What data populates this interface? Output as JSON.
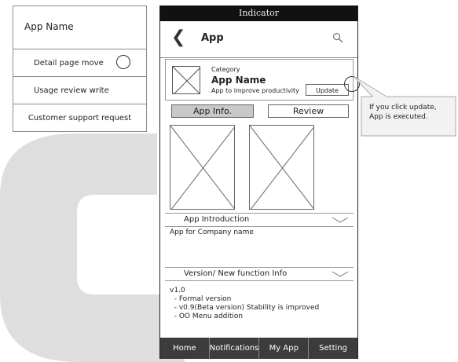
{
  "menu": {
    "title": "App Name",
    "items": [
      {
        "label": "Detail page move"
      },
      {
        "label": "Usage review write"
      },
      {
        "label": "Customer support request"
      }
    ]
  },
  "phone": {
    "status_title": "Indicator",
    "nav": {
      "back_icon": "chevron-left-icon",
      "title": "App",
      "search_icon": "search-icon"
    },
    "app": {
      "category": "Category",
      "name": "App Name",
      "description": "App to improve productivity",
      "update_label": "Update"
    },
    "tabs": [
      {
        "label": "App Info."
      },
      {
        "label": "Review"
      }
    ],
    "intro": {
      "title": "App Introduction",
      "text": "App for Company name"
    },
    "version_section": {
      "title": "Version/ New function Info",
      "lines": [
        "v1.0",
        "  - Formal version",
        "  - v0.9(Beta version) Stability is improved",
        "  - OO Menu addition"
      ]
    },
    "tabbar": [
      {
        "label": "Home"
      },
      {
        "label": "Notifications"
      },
      {
        "label": "My App"
      },
      {
        "label": "Setting"
      }
    ]
  },
  "callout": {
    "line1": "If you click update,",
    "line2": "App is executed."
  },
  "colors": {
    "watermark": "#dedede",
    "statusbar": "#111111",
    "tabbar": "#3c3c3c",
    "active_tab": "#c8c8c8",
    "callout": "#f2f2f2"
  }
}
